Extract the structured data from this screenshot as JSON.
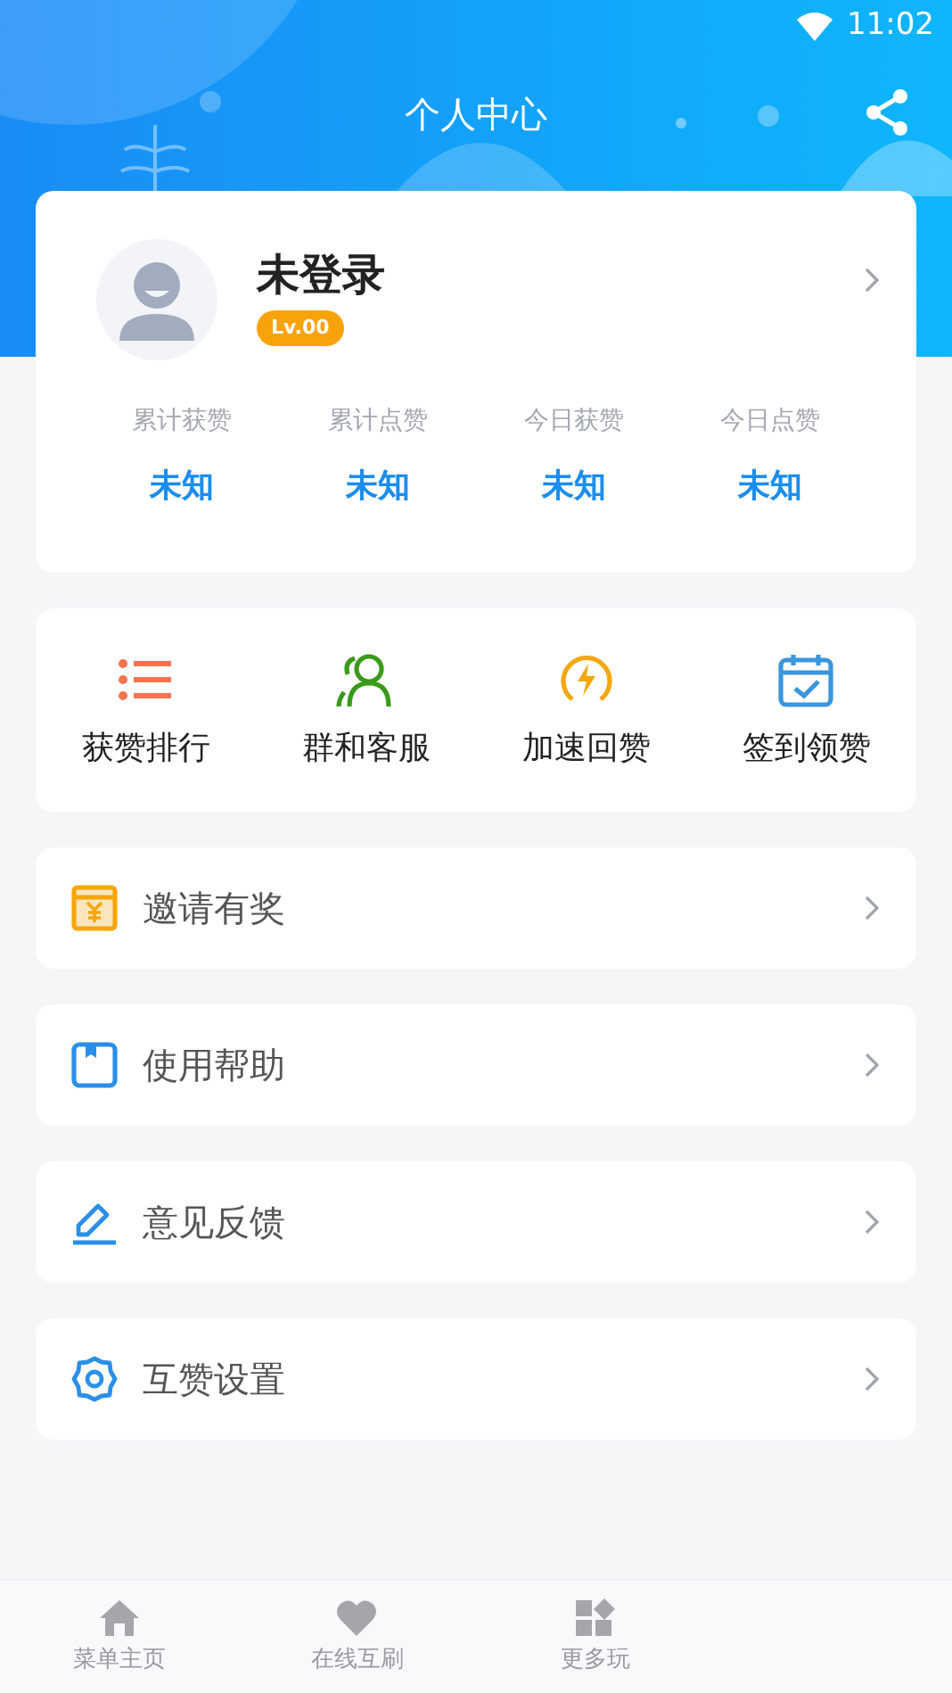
{
  "status_bar": {
    "time": "11:02"
  },
  "header": {
    "title": "个人中心"
  },
  "profile": {
    "name": "未登录",
    "level_badge": "Lv.00",
    "stats": [
      {
        "label": "累计获赞",
        "value": "未知"
      },
      {
        "label": "累计点赞",
        "value": "未知"
      },
      {
        "label": "今日获赞",
        "value": "未知"
      },
      {
        "label": "今日点赞",
        "value": "未知"
      }
    ]
  },
  "shortcuts": [
    {
      "kind": "list",
      "label": "获赞排行",
      "color": "#f4754f"
    },
    {
      "kind": "group",
      "label": "群和客服",
      "color": "#3a9a1a"
    },
    {
      "kind": "bolt",
      "label": "加速回赞",
      "color": "#f5a60a"
    },
    {
      "kind": "calendar",
      "label": "签到领赞",
      "color": "#3a96dd"
    }
  ],
  "menu": [
    {
      "kind": "gift",
      "label": "邀请有奖"
    },
    {
      "kind": "book",
      "label": "使用帮助"
    },
    {
      "kind": "pen",
      "label": "意见反馈"
    },
    {
      "kind": "gear",
      "label": "互赞设置"
    }
  ],
  "bottom_nav": [
    {
      "kind": "home",
      "label": "菜单主页"
    },
    {
      "kind": "heart",
      "label": "在线互刷"
    },
    {
      "kind": "apps",
      "label": "更多玩"
    }
  ]
}
